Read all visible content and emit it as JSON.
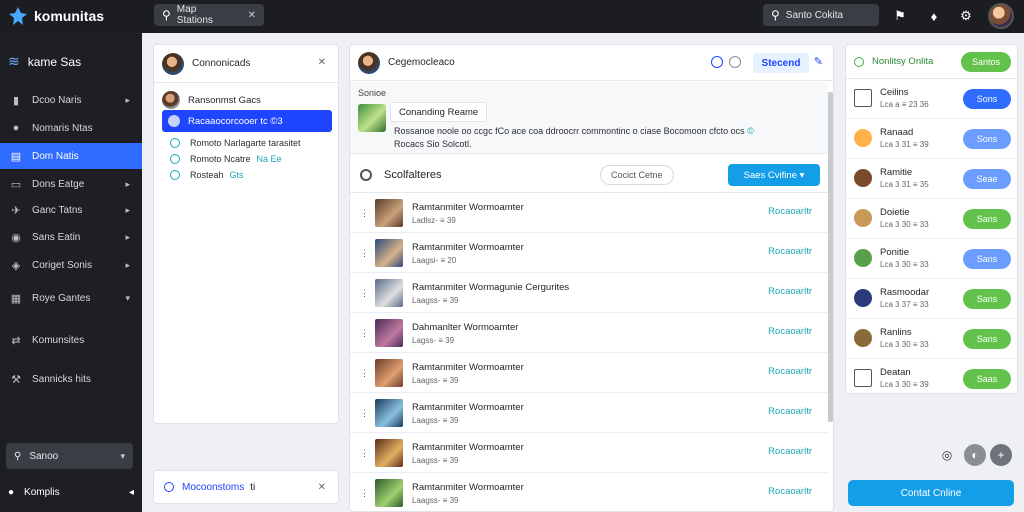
{
  "app": {
    "name": "komunitas"
  },
  "search": {
    "label": "Map Stations"
  },
  "top_search": {
    "label": "Santo Cokita"
  },
  "sidebar": {
    "brand": "kame Sas",
    "items": [
      {
        "label": "Dcoo Naris",
        "icon": "chart-icon"
      },
      {
        "label": "Nomaris Ntas",
        "icon": "camera-icon"
      },
      {
        "label": "Dom Natis",
        "icon": "calendar-icon"
      },
      {
        "label": "Dons Eatge",
        "icon": "inbox-icon"
      },
      {
        "label": "Ganc Tatns",
        "icon": "bird-icon"
      },
      {
        "label": "Sans Eatin",
        "icon": "shield-icon"
      },
      {
        "label": "Coriget Sonis",
        "icon": "pin-icon"
      },
      {
        "label": "Roye Gantes",
        "icon": "grid-icon"
      },
      {
        "label": "Komunsites",
        "icon": "share-icon"
      },
      {
        "label": "Sannicks hits",
        "icon": "wrench-icon"
      }
    ],
    "search_label": "Sanoo",
    "footer_label": "Komplis"
  },
  "panel_left": {
    "title": "Connonicads",
    "items": [
      "Ransonmst Gacs",
      "Racaaocorcooer tc ©3"
    ],
    "options": [
      {
        "label": "Romoto Narlagarte tarasitet",
        "tag": ""
      },
      {
        "label": "Romoto Ncatre",
        "tag": "Na Ee"
      },
      {
        "label": "Rosteah",
        "tag": "Gts"
      }
    ],
    "footer_a": "Mocoonstoms",
    "footer_b": "ti"
  },
  "panel_mid": {
    "title": "Cegemocleaco",
    "status": "Stecend",
    "info_label": "Sonioe",
    "chip": "Conanding Reame",
    "desc": "Rossanoe noole oo ccgc fCo ace coa ddroocrr commontinc o ciase Bocomoon cfcto ocs",
    "desc_link": "©",
    "desc2": "Rocacs Sio Solcotl.",
    "section_title": "Scolfalteres",
    "ghost_btn": "Cocict Cetne",
    "primary_btn": "Saes Cvifine",
    "items": [
      {
        "name": "Ramtanmiter Wormoamter",
        "meta": "Ladlsz-  ≡ 39",
        "action": "Rocaoarltr",
        "colors": [
          "#5a3a2a",
          "#c9a27a"
        ]
      },
      {
        "name": "Ramtanmiter Wormoamter",
        "meta": "Laagsi-  ≡ 20",
        "action": "Rocaoarltr",
        "colors": [
          "#2a4a7a",
          "#d6b28a"
        ]
      },
      {
        "name": "Ramtanmiter Wormagunie Cergurites",
        "meta": "Laagss-  ≡ 39",
        "action": "Rocaoarltr",
        "colors": [
          "#5a6a8a",
          "#dedede"
        ]
      },
      {
        "name": "Dahmanlter Wormoamter",
        "meta": "Lagss-  ≡ 39",
        "action": "Rocaoarltr",
        "colors": [
          "#4a2a5a",
          "#c07aa0"
        ]
      },
      {
        "name": "Ramtanmiter Wormoamter",
        "meta": "Laagss-  ≡ 39",
        "action": "Rocaoarltr",
        "colors": [
          "#6a3a2a",
          "#e0a070"
        ]
      },
      {
        "name": "Ramtanmiter Wormoamter",
        "meta": "Laagss-  ≡ 39",
        "action": "Rocaoarltr",
        "colors": [
          "#1a3a5a",
          "#8ac0e0"
        ]
      },
      {
        "name": "Ramtanmiter Wormoamter",
        "meta": "Laagss-  ≡ 39",
        "action": "Rocaoarltr",
        "colors": [
          "#5a2a1a",
          "#e0b060"
        ]
      },
      {
        "name": "Ramtanmiter Wormoamter",
        "meta": "Laagss-  ≡ 39",
        "action": "Rocaoarltr",
        "colors": [
          "#2a5a2a",
          "#a0d070"
        ]
      }
    ]
  },
  "panel_right": {
    "title": "Nonlitsy Onlita",
    "header_btn": "Santos",
    "rows": [
      {
        "name": "Ceilins",
        "meta": "Lca a  ≡ 23 36",
        "btn": "Sons",
        "btn_color": "#2f6bff",
        "pic": "#ffffff"
      },
      {
        "name": "Ranaad",
        "meta": "Lca 3 31  ≡ 39",
        "btn": "Sons",
        "btn_color": "#6a9dff",
        "pic": "#ffb24a"
      },
      {
        "name": "Ramitie",
        "meta": "Lca 3 31  ≡ 35",
        "btn": "Seae",
        "btn_color": "#6a9dff",
        "pic": "#7a4a2a"
      },
      {
        "name": "Doietie",
        "meta": "Lca 3 30  ≡ 33",
        "btn": "Sans",
        "btn_color": "#62c24b",
        "pic": "#c79a5a"
      },
      {
        "name": "Ponitie",
        "meta": "Lca 3 30  ≡ 33",
        "btn": "Sans",
        "btn_color": "#6a9dff",
        "pic": "#5aa04a"
      },
      {
        "name": "Rasmoodar",
        "meta": "Lca 3 37  ≡ 33",
        "btn": "Sans",
        "btn_color": "#62c24b",
        "pic": "#2a3a7a"
      },
      {
        "name": "Ranlins",
        "meta": "Lca 3 30  ≡ 33",
        "btn": "Sans",
        "btn_color": "#62c24b",
        "pic": "#8a6a3a"
      },
      {
        "name": "Deatan",
        "meta": "Lca 3 30  ≡ 39",
        "btn": "Saas",
        "btn_color": "#62c24b",
        "pic": "#ffffff"
      }
    ],
    "cta": "Contat Cnline"
  },
  "colors": {
    "accent": "#2f6bff",
    "teal": "#1aa6b7",
    "green": "#62c24b",
    "sky": "#159ee8"
  }
}
